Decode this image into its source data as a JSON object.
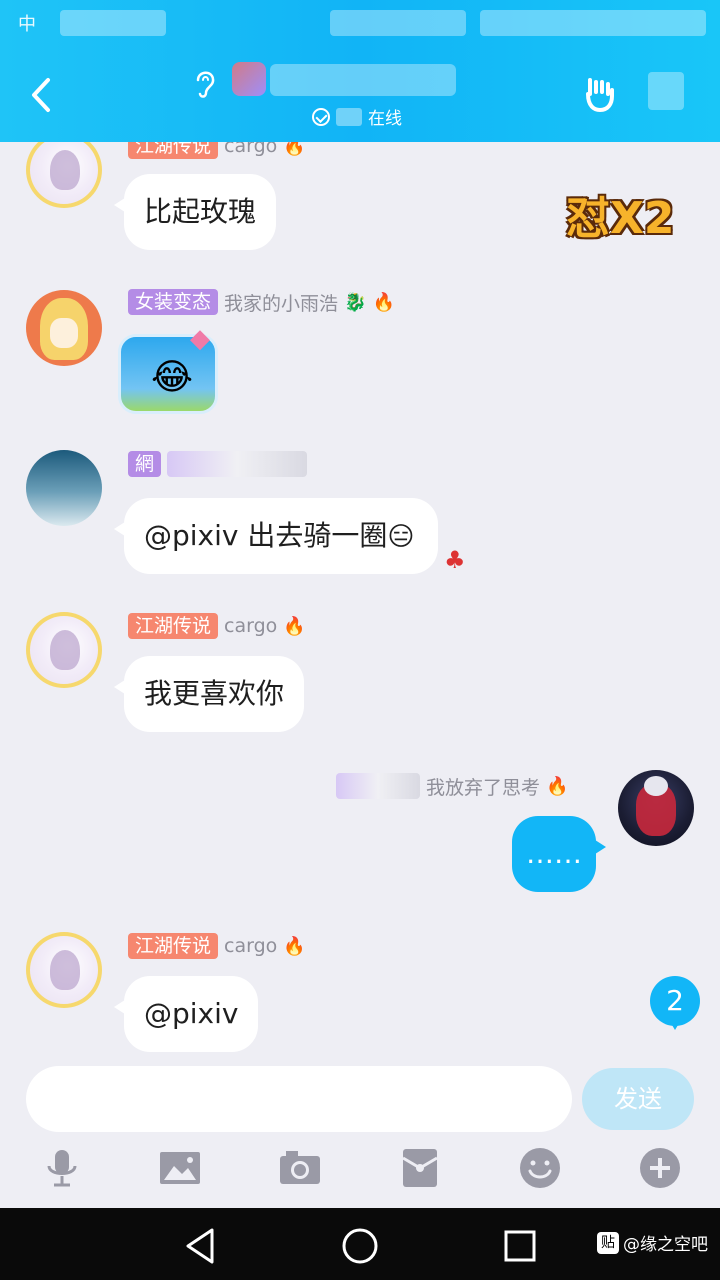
{
  "status_bar": {
    "carrier": "中"
  },
  "header": {
    "online_text": "在线"
  },
  "messages": [
    {
      "title": "江湖传说",
      "name": "cargo",
      "text": "比起玫瑰"
    },
    {
      "title": "女装变态",
      "name": "我家的小雨浩",
      "text": "😂"
    },
    {
      "title": "網",
      "text": "@pixiv 出去骑一圈"
    },
    {
      "title": "江湖传说",
      "name": "cargo",
      "text": "我更喜欢你"
    },
    {
      "name": "我放弃了思考",
      "text": "……"
    },
    {
      "title": "江湖传说",
      "name": "cargo",
      "text": "@pixiv"
    }
  ],
  "sticker_text": "怼X2",
  "unread_count": "2",
  "input": {
    "placeholder": "",
    "send_label": "发送"
  },
  "watermark": {
    "badge": "贴",
    "text": "@缘之空吧"
  },
  "colors": {
    "accent": "#12b6f7",
    "header": "#1fc4f7",
    "title_red": "#f6876f",
    "title_purple": "#b48ce6"
  }
}
